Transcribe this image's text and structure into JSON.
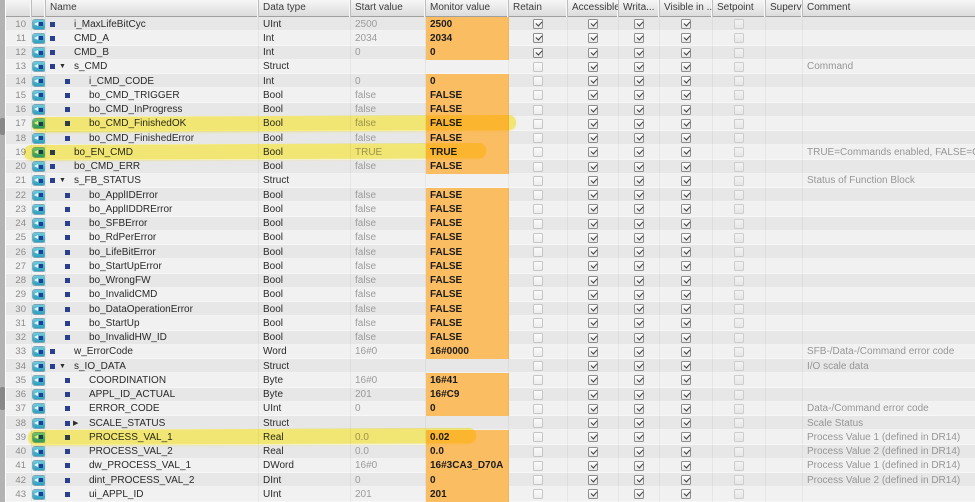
{
  "table": {
    "columns": [
      {
        "id": "num",
        "label": ""
      },
      {
        "id": "icon",
        "label": ""
      },
      {
        "id": "name",
        "label": "Name"
      },
      {
        "id": "data_type",
        "label": "Data type"
      },
      {
        "id": "start_value",
        "label": "Start value"
      },
      {
        "id": "monitor_value",
        "label": "Monitor value"
      },
      {
        "id": "retain",
        "label": "Retain"
      },
      {
        "id": "accessible",
        "label": "Accessible f..."
      },
      {
        "id": "writable",
        "label": "Writa..."
      },
      {
        "id": "visible",
        "label": "Visible in ..."
      },
      {
        "id": "setpoint",
        "label": "Setpoint"
      },
      {
        "id": "supervision",
        "label": "Supervis..."
      },
      {
        "id": "comment",
        "label": "Comment"
      }
    ],
    "checkbox_defaults": {
      "accessible": true,
      "writable": true,
      "visible": true,
      "setpoint": false,
      "supervision": null
    },
    "highlighted_rows": [
      17,
      19,
      39
    ],
    "rows": [
      {
        "num": 10,
        "level": 1,
        "expand": null,
        "name": "i_MaxLifeBitCyc",
        "data_type": "UInt",
        "start_value": "2500",
        "monitor_value": "2500",
        "monitor_bg": true,
        "retain": true,
        "comment": ""
      },
      {
        "num": 11,
        "level": 1,
        "expand": null,
        "name": "CMD_A",
        "data_type": "Int",
        "start_value": "2034",
        "monitor_value": "2034",
        "monitor_bg": true,
        "retain": true,
        "comment": ""
      },
      {
        "num": 12,
        "level": 1,
        "expand": null,
        "name": "CMD_B",
        "data_type": "Int",
        "start_value": "0",
        "monitor_value": "0",
        "monitor_bg": true,
        "retain": true,
        "comment": ""
      },
      {
        "num": 13,
        "level": 1,
        "expand": "open",
        "name": "s_CMD",
        "data_type": "Struct",
        "start_value": "",
        "monitor_value": "",
        "monitor_bg": false,
        "retain": false,
        "comment": "Command"
      },
      {
        "num": 14,
        "level": 2,
        "expand": null,
        "name": "i_CMD_CODE",
        "data_type": "Int",
        "start_value": "0",
        "monitor_value": "0",
        "monitor_bg": true,
        "retain": false,
        "comment": ""
      },
      {
        "num": 15,
        "level": 2,
        "expand": null,
        "name": "bo_CMD_TRIGGER",
        "data_type": "Bool",
        "start_value": "false",
        "monitor_value": "FALSE",
        "monitor_bg": true,
        "retain": false,
        "comment": ""
      },
      {
        "num": 16,
        "level": 2,
        "expand": null,
        "name": "bo_CMD_InProgress",
        "data_type": "Bool",
        "start_value": "false",
        "monitor_value": "FALSE",
        "monitor_bg": true,
        "retain": false,
        "comment": ""
      },
      {
        "num": 17,
        "level": 2,
        "expand": null,
        "name": "bo_CMD_FinishedOK",
        "data_type": "Bool",
        "start_value": "false",
        "monitor_value": "FALSE",
        "monitor_bg": true,
        "retain": false,
        "comment": ""
      },
      {
        "num": 18,
        "level": 2,
        "expand": null,
        "name": "bo_CMD_FinishedError",
        "data_type": "Bool",
        "start_value": "false",
        "monitor_value": "FALSE",
        "monitor_bg": true,
        "retain": false,
        "comment": ""
      },
      {
        "num": 19,
        "level": 1,
        "expand": null,
        "name": "bo_EN_CMD",
        "data_type": "Bool",
        "start_value": "TRUE",
        "monitor_value": "TRUE",
        "monitor_bg": true,
        "retain": false,
        "comment": "TRUE=Commands enabled, FALSE=Com"
      },
      {
        "num": 20,
        "level": 1,
        "expand": null,
        "name": "bo_CMD_ERR",
        "data_type": "Bool",
        "start_value": "false",
        "monitor_value": "FALSE",
        "monitor_bg": true,
        "retain": false,
        "comment": ""
      },
      {
        "num": 21,
        "level": 1,
        "expand": "open",
        "name": "s_FB_STATUS",
        "data_type": "Struct",
        "start_value": "",
        "monitor_value": "",
        "monitor_bg": false,
        "retain": false,
        "comment": "Status of Function Block"
      },
      {
        "num": 22,
        "level": 2,
        "expand": null,
        "name": "bo_ApplIDError",
        "data_type": "Bool",
        "start_value": "false",
        "monitor_value": "FALSE",
        "monitor_bg": true,
        "retain": false,
        "comment": ""
      },
      {
        "num": 23,
        "level": 2,
        "expand": null,
        "name": "bo_ApplIDDRError",
        "data_type": "Bool",
        "start_value": "false",
        "monitor_value": "FALSE",
        "monitor_bg": true,
        "retain": false,
        "comment": ""
      },
      {
        "num": 24,
        "level": 2,
        "expand": null,
        "name": "bo_SFBError",
        "data_type": "Bool",
        "start_value": "false",
        "monitor_value": "FALSE",
        "monitor_bg": true,
        "retain": false,
        "comment": ""
      },
      {
        "num": 25,
        "level": 2,
        "expand": null,
        "name": "bo_RdPerError",
        "data_type": "Bool",
        "start_value": "false",
        "monitor_value": "FALSE",
        "monitor_bg": true,
        "retain": false,
        "comment": ""
      },
      {
        "num": 26,
        "level": 2,
        "expand": null,
        "name": "bo_LifeBitError",
        "data_type": "Bool",
        "start_value": "false",
        "monitor_value": "FALSE",
        "monitor_bg": true,
        "retain": false,
        "comment": ""
      },
      {
        "num": 27,
        "level": 2,
        "expand": null,
        "name": "bo_StartUpError",
        "data_type": "Bool",
        "start_value": "false",
        "monitor_value": "FALSE",
        "monitor_bg": true,
        "retain": false,
        "comment": ""
      },
      {
        "num": 28,
        "level": 2,
        "expand": null,
        "name": "bo_WrongFW",
        "data_type": "Bool",
        "start_value": "false",
        "monitor_value": "FALSE",
        "monitor_bg": true,
        "retain": false,
        "comment": ""
      },
      {
        "num": 29,
        "level": 2,
        "expand": null,
        "name": "bo_InvalidCMD",
        "data_type": "Bool",
        "start_value": "false",
        "monitor_value": "FALSE",
        "monitor_bg": true,
        "retain": false,
        "comment": ""
      },
      {
        "num": 30,
        "level": 2,
        "expand": null,
        "name": "bo_DataOperationError",
        "data_type": "Bool",
        "start_value": "false",
        "monitor_value": "FALSE",
        "monitor_bg": true,
        "retain": false,
        "comment": ""
      },
      {
        "num": 31,
        "level": 2,
        "expand": null,
        "name": "bo_StartUp",
        "data_type": "Bool",
        "start_value": "false",
        "monitor_value": "FALSE",
        "monitor_bg": true,
        "retain": false,
        "comment": ""
      },
      {
        "num": 32,
        "level": 2,
        "expand": null,
        "name": "bo_InvalidHW_ID",
        "data_type": "Bool",
        "start_value": "false",
        "monitor_value": "FALSE",
        "monitor_bg": true,
        "retain": false,
        "comment": ""
      },
      {
        "num": 33,
        "level": 1,
        "expand": null,
        "name": "w_ErrorCode",
        "data_type": "Word",
        "start_value": "16#0",
        "monitor_value": "16#0000",
        "monitor_bg": true,
        "retain": false,
        "comment": "SFB-/Data-/Command error code"
      },
      {
        "num": 34,
        "level": 1,
        "expand": "open",
        "name": "s_IO_DATA",
        "data_type": "Struct",
        "start_value": "",
        "monitor_value": "",
        "monitor_bg": false,
        "retain": false,
        "comment": "I/O scale data"
      },
      {
        "num": 35,
        "level": 2,
        "expand": null,
        "name": "COORDINATION",
        "data_type": "Byte",
        "start_value": "16#0",
        "monitor_value": "16#41",
        "monitor_bg": true,
        "retain": false,
        "comment": ""
      },
      {
        "num": 36,
        "level": 2,
        "expand": null,
        "name": "APPL_ID_ACTUAL",
        "data_type": "Byte",
        "start_value": "201",
        "monitor_value": "16#C9",
        "monitor_bg": true,
        "retain": false,
        "comment": ""
      },
      {
        "num": 37,
        "level": 2,
        "expand": null,
        "name": "ERROR_CODE",
        "data_type": "UInt",
        "start_value": "0",
        "monitor_value": "0",
        "monitor_bg": true,
        "retain": false,
        "comment": "Data-/Command error code"
      },
      {
        "num": 38,
        "level": 2,
        "expand": "closed",
        "name": "SCALE_STATUS",
        "data_type": "Struct",
        "start_value": "",
        "monitor_value": "",
        "monitor_bg": false,
        "retain": false,
        "comment": "Scale Status"
      },
      {
        "num": 39,
        "level": 2,
        "expand": null,
        "name": "PROCESS_VAL_1",
        "data_type": "Real",
        "start_value": "0.0",
        "monitor_value": "0.02",
        "monitor_bg": true,
        "retain": false,
        "comment": "Process Value 1 (defined in DR14)"
      },
      {
        "num": 40,
        "level": 2,
        "expand": null,
        "name": "PROCESS_VAL_2",
        "data_type": "Real",
        "start_value": "0.0",
        "monitor_value": "0.0",
        "monitor_bg": true,
        "retain": false,
        "comment": "Process Value 2 (defined in DR14)"
      },
      {
        "num": 41,
        "level": 2,
        "expand": null,
        "name": "dw_PROCESS_VAL_1",
        "data_type": "DWord",
        "start_value": "16#0",
        "monitor_value": "16#3CA3_D70A",
        "monitor_bg": true,
        "retain": false,
        "comment": "Process Value 1 (defined in DR14)"
      },
      {
        "num": 42,
        "level": 2,
        "expand": null,
        "name": "dint_PROCESS_VAL_2",
        "data_type": "DInt",
        "start_value": "0",
        "monitor_value": "0",
        "monitor_bg": true,
        "retain": false,
        "comment": "Process Value 2 (defined in DR14)"
      },
      {
        "num": 43,
        "level": 2,
        "expand": null,
        "name": "ui_APPL_ID",
        "data_type": "UInt",
        "start_value": "201",
        "monitor_value": "201",
        "monitor_bg": true,
        "retain": false,
        "comment": ""
      }
    ]
  },
  "colors": {
    "monitor_orange": "#fbbd62",
    "highlighter_yellow": "#ffe900",
    "tag_icon_teal": "#3fb6cf",
    "element_marker_blue": "#2b3f8f"
  }
}
